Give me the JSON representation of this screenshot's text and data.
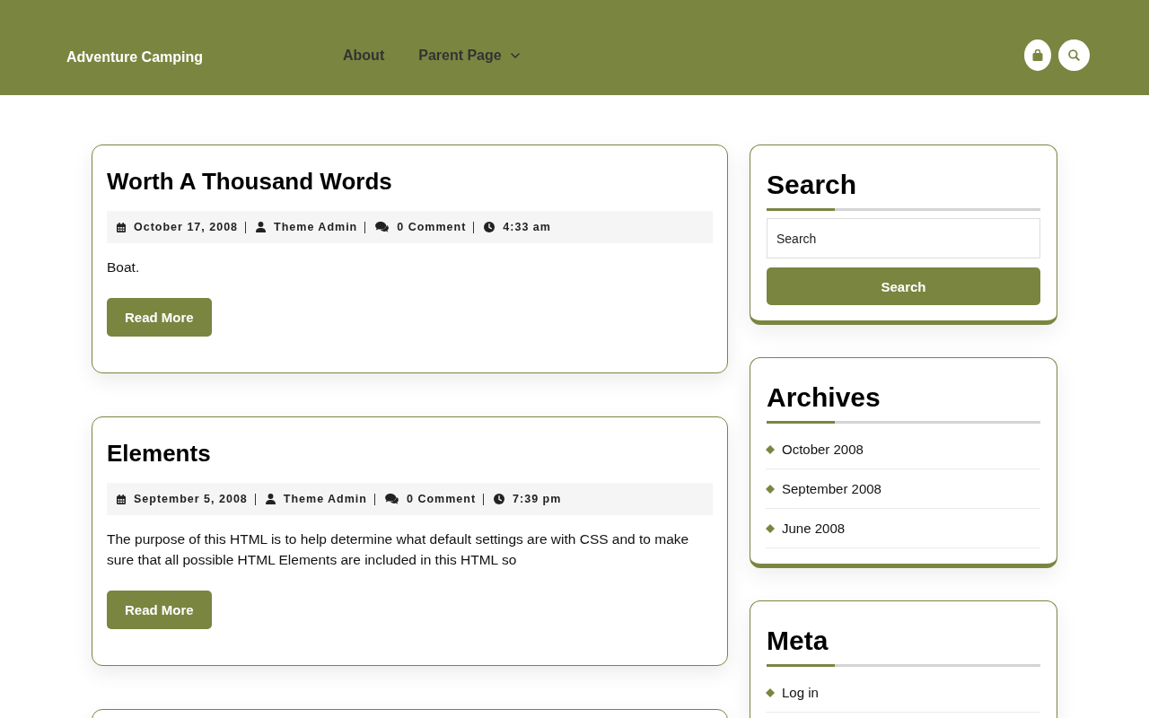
{
  "header": {
    "site_title": "Adventure Camping",
    "nav": [
      {
        "label": "About",
        "has_submenu": false
      },
      {
        "label": "Parent Page",
        "has_submenu": true
      }
    ]
  },
  "posts": [
    {
      "title": "Worth A Thousand Words",
      "meta": [
        {
          "kind": "date",
          "text": "October 17, 2008"
        },
        {
          "kind": "author",
          "text": "Theme Admin"
        },
        {
          "kind": "comments",
          "text": "0 Comment"
        },
        {
          "kind": "time",
          "text": "4:33 am"
        }
      ],
      "excerpt": "Boat.",
      "button": "Read More"
    },
    {
      "title": "Elements",
      "meta": [
        {
          "kind": "date",
          "text": "September 5, 2008"
        },
        {
          "kind": "author",
          "text": "Theme Admin"
        },
        {
          "kind": "comments",
          "text": "0 Comment"
        },
        {
          "kind": "time",
          "text": "7:39 pm"
        }
      ],
      "excerpt": "The purpose of this HTML is to help determine what default settings are with CSS and to make sure that all possible HTML Elements are included in this HTML so",
      "button": "Read More"
    }
  ],
  "sidebar": {
    "widgets": [
      {
        "kind": "search",
        "title": "Search",
        "placeholder": "Search",
        "button": "Search"
      },
      {
        "kind": "links",
        "title": "Archives",
        "items": [
          "October 2008",
          "September 2008",
          "June 2008"
        ]
      },
      {
        "kind": "links",
        "title": "Meta",
        "items": [
          "Log in"
        ]
      }
    ]
  }
}
